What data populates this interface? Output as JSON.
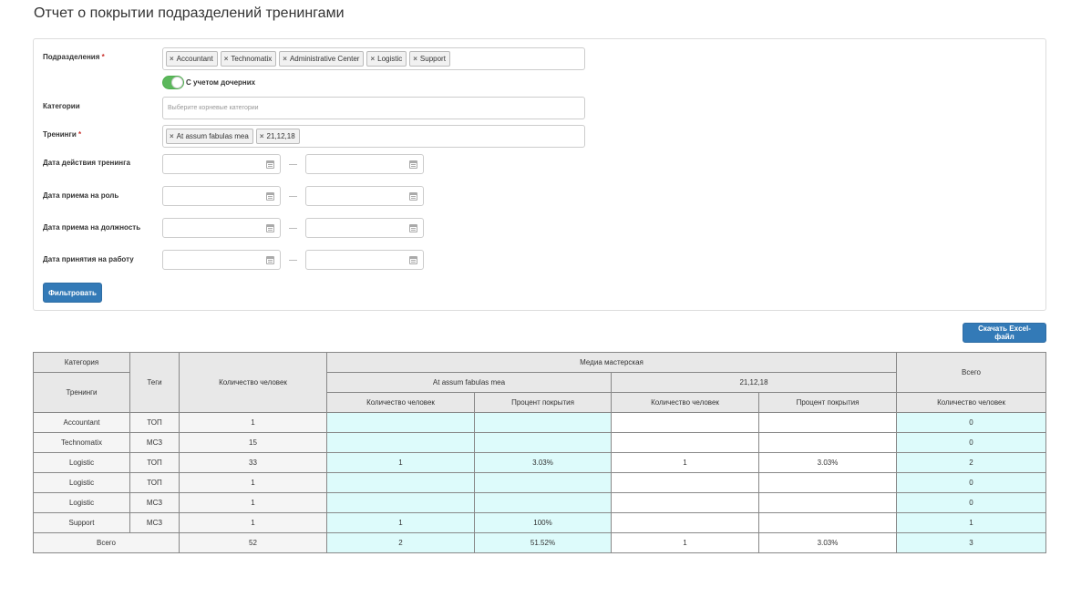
{
  "page_title": "Отчет о покрытии подразделений тренингами",
  "filters": {
    "departments_label": "Подразделения",
    "required_mark": "*",
    "departments": [
      "Accountant",
      "Technomatix",
      "Administrative Center",
      "Logistic",
      "Support"
    ],
    "include_children_label": "С учетом дочерних",
    "categories_label": "Категории",
    "categories_placeholder": "Выберите корневые категории",
    "trainings_label": "Тренинги",
    "trainings": [
      "At assum fabulas mea",
      "21,12,18"
    ],
    "date_training_label": "Дата действия тренинга",
    "date_role_label": "Дата приема на роль",
    "date_position_label": "Дата приема на должность",
    "date_hired_label": "Дата принятия на работу",
    "filter_button": "Фильтровать"
  },
  "excel_button": "Скачать Excel-файл",
  "table": {
    "h_category": "Категория",
    "h_trainings": "Тренинги",
    "h_tags": "Теги",
    "h_people": "Количество человек",
    "h_group": "Медиа мастерская",
    "h_training1": "At assum fabulas mea",
    "h_training2": "21,12,18",
    "h_total": "Всего",
    "h_people_short": "Количество человек",
    "h_coverage": "Процент покрытия",
    "rows": [
      {
        "name": "Accountant",
        "tag": "ТОП",
        "people": "1",
        "t1_people": "",
        "t1_cov": "",
        "t2_people": "",
        "t2_cov": "",
        "total": "0"
      },
      {
        "name": "Technomatix",
        "tag": "МСЗ",
        "people": "15",
        "t1_people": "",
        "t1_cov": "",
        "t2_people": "",
        "t2_cov": "",
        "total": "0"
      },
      {
        "name": "Logistic",
        "tag": "ТОП",
        "people": "33",
        "t1_people": "1",
        "t1_cov": "3.03%",
        "t2_people": "1",
        "t2_cov": "3.03%",
        "total": "2"
      },
      {
        "name": "Logistic",
        "tag": "ТОП",
        "people": "1",
        "t1_people": "",
        "t1_cov": "",
        "t2_people": "",
        "t2_cov": "",
        "total": "0"
      },
      {
        "name": "Logistic",
        "tag": "МСЗ",
        "people": "1",
        "t1_people": "",
        "t1_cov": "",
        "t2_people": "",
        "t2_cov": "",
        "total": "0"
      },
      {
        "name": "Support",
        "tag": "МСЗ",
        "people": "1",
        "t1_people": "1",
        "t1_cov": "100%",
        "t2_people": "",
        "t2_cov": "",
        "total": "1"
      }
    ],
    "footer": {
      "label": "Всего",
      "people": "52",
      "t1_people": "2",
      "t1_cov": "51.52%",
      "t2_people": "1",
      "t2_cov": "3.03%",
      "total": "3"
    }
  }
}
